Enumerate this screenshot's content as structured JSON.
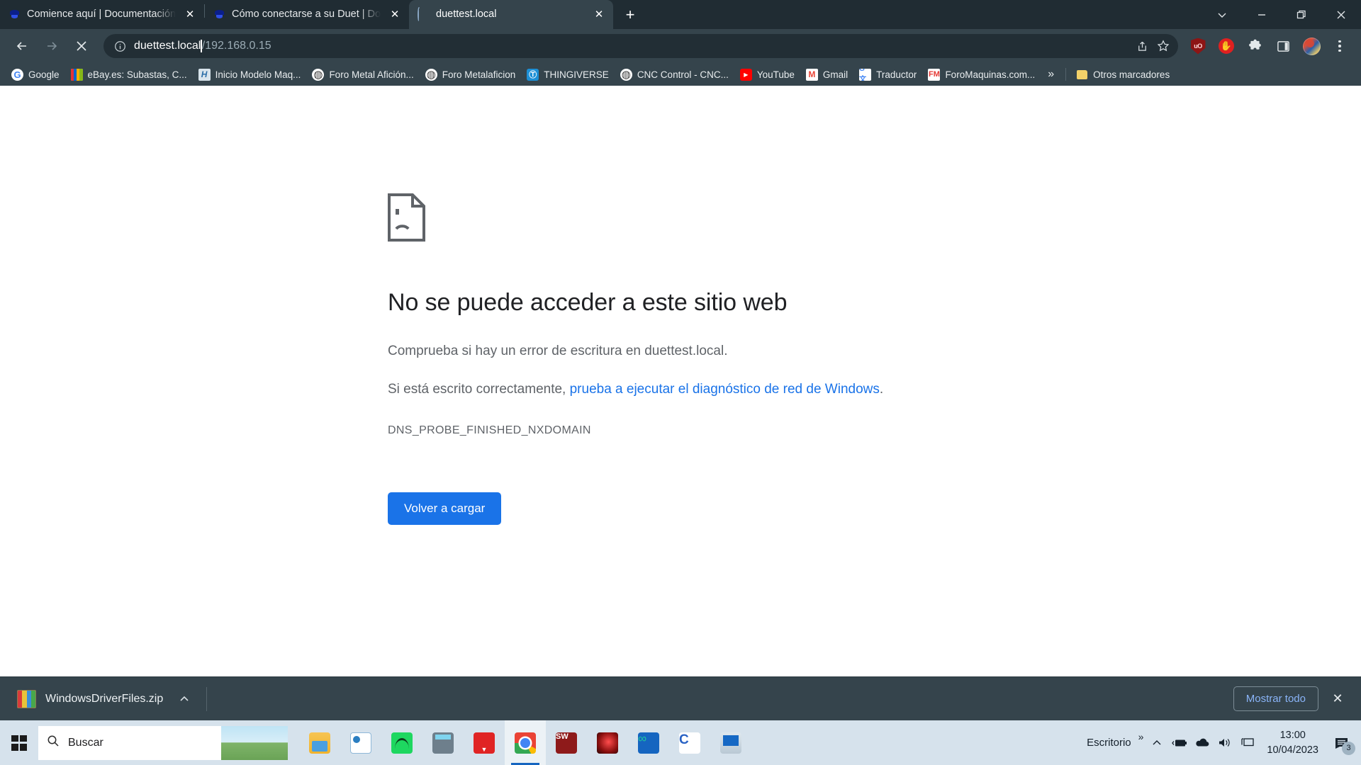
{
  "browser": {
    "tabs": [
      {
        "title": "Comience aquí | Documentación",
        "favicon": "duet-droplet-icon",
        "active": false
      },
      {
        "title": "Cómo conectarse a su Duet | Doc",
        "favicon": "duet-droplet-icon",
        "active": false
      },
      {
        "title": "duettest.local",
        "favicon": "loading-spinner-icon",
        "active": true
      }
    ],
    "new_tab_label": "+",
    "tab_close_label": "✕",
    "window_controls": {
      "tab_search": "chevron-down-icon",
      "minimize": "minimize-icon",
      "restore": "restore-icon",
      "close": "close-icon"
    },
    "toolbar": {
      "back": "back-arrow-icon",
      "forward": "forward-arrow-icon",
      "stop": "stop-loading-icon",
      "site_info": "info-circle-icon",
      "url_host": "duettest.local",
      "url_path": "/192.168.0.15",
      "share": "share-icon",
      "bookmark_star": "star-icon",
      "ublock_label": "uO",
      "adblock_label": "✋",
      "extensions": "puzzle-piece-icon",
      "side_panel": "side-panel-icon",
      "profile": "avatar",
      "menu": "three-dot-menu-icon"
    },
    "bookmarks": {
      "items": [
        {
          "label": "Google",
          "icon": "google-icon"
        },
        {
          "label": "eBay.es: Subastas, C...",
          "icon": "ebay-icon"
        },
        {
          "label": "Inicio Modelo Maq...",
          "icon": "h-letter-icon"
        },
        {
          "label": "Foro Metal Afición...",
          "icon": "globe-icon"
        },
        {
          "label": "Foro Metalaficion",
          "icon": "globe-icon"
        },
        {
          "label": "THINGIVERSE",
          "icon": "thingiverse-icon"
        },
        {
          "label": "CNC Control - CNC...",
          "icon": "globe-icon"
        },
        {
          "label": "YouTube",
          "icon": "youtube-icon"
        },
        {
          "label": "Gmail",
          "icon": "gmail-icon"
        },
        {
          "label": "Traductor",
          "icon": "google-translate-icon"
        },
        {
          "label": "ForoMaquinas.com...",
          "icon": "foromaquinas-icon"
        }
      ],
      "overflow_label": "»",
      "other_bookmarks_label": "Otros marcadores",
      "other_bookmarks_icon": "folder-icon"
    }
  },
  "error_page": {
    "icon": "sad-page-icon",
    "title": "No se puede acceder a este sitio web",
    "paragraph_1": "Comprueba si hay un error de escritura en duettest.local.",
    "paragraph_2_prefix": "Si está escrito correctamente, ",
    "paragraph_2_link": "prueba a ejecutar el diagnóstico de red de Windows",
    "paragraph_2_suffix": ".",
    "error_code": "DNS_PROBE_FINISHED_NXDOMAIN",
    "reload_button": "Volver a cargar",
    "accent_color": "#1a73e8"
  },
  "download_shelf": {
    "file_name": "WindowsDriverFiles.zip",
    "file_icon": "zip-archive-icon",
    "expand_icon": "chevron-up-icon",
    "show_all_label": "Mostrar todo",
    "close_label": "✕"
  },
  "taskbar": {
    "start_icon": "windows-logo-icon",
    "search_placeholder": "Buscar",
    "search_icon": "search-icon",
    "search_widget": "camping-tent-image",
    "apps": [
      {
        "name": "file-explorer",
        "class": "g-explorer",
        "label": ""
      },
      {
        "name": "office-outlook",
        "class": "g-office",
        "label": ""
      },
      {
        "name": "spotify",
        "class": "g-spotify",
        "label": ""
      },
      {
        "name": "calculator",
        "class": "g-calc",
        "label": ""
      },
      {
        "name": "video-downloader",
        "class": "g-video",
        "label": ""
      },
      {
        "name": "google-chrome",
        "class": "g-chrome",
        "label": "",
        "active": true
      },
      {
        "name": "solidworks",
        "class": "g-sw",
        "label": "SW"
      },
      {
        "name": "red-app",
        "class": "g-red",
        "label": ""
      },
      {
        "name": "arduino-ide",
        "class": "g-arduino",
        "label": ""
      },
      {
        "name": "cura-app",
        "class": "g-c",
        "label": "C"
      },
      {
        "name": "remote-desktop",
        "class": "g-monitor",
        "label": ""
      }
    ],
    "tray": {
      "desktop_label": "Escritorio",
      "overflow_mark": "»",
      "show_hidden_icon": "chevron-up-icon",
      "battery_icon": "battery-charging-icon",
      "onedrive_icon": "cloud-icon",
      "volume_icon": "speaker-icon",
      "network_icon": "monitor-network-icon",
      "time": "13:00",
      "date": "10/04/2023",
      "notifications_icon": "notification-icon",
      "notifications_count": "3"
    }
  }
}
